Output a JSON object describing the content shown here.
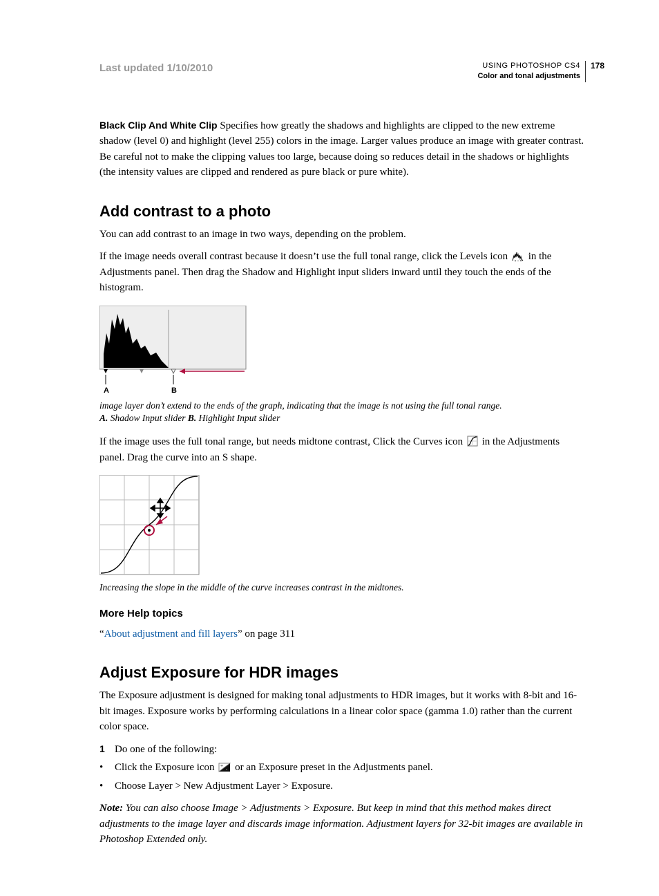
{
  "header": {
    "lastUpdated": "Last updated 1/10/2010",
    "product": "USING PHOTOSHOP CS4",
    "chapter": "Color and tonal adjustments",
    "pageNumber": "178"
  },
  "blackWhiteClip": {
    "runIn": "Black Clip And White Clip",
    "body": " Specifies how greatly the shadows and highlights are clipped to the new extreme shadow (level 0) and highlight (level 255) colors in the image. Larger values produce an image with greater contrast. Be careful not to make the clipping values too large, because doing so reduces detail in the shadows or highlights (the intensity values are clipped and rendered as pure black or pure white)."
  },
  "section1": {
    "heading": "Add contrast to a photo",
    "p1": "You can add contrast to an image in two ways, depending on the problem.",
    "p2a": "If the image needs overall contrast because it doesn’t use the full tonal range, click the Levels icon ",
    "p2b": " in the Adjustments panel. Then drag the Shadow and Highlight input sliders inward until they touch the ends of the histogram.",
    "caption1Line1": "image layer don’t extend to the ends of the graph, indicating that the image is not using the full tonal range.",
    "caption1ALabel": "A.",
    "caption1AText": " Shadow Input slider  ",
    "caption1BLabel": "B.",
    "caption1BText": " Highlight Input slider",
    "p3a": "If the image uses the full tonal range, but needs midtone contrast, Click the Curves icon ",
    "p3b": " in the Adjustments panel. Drag the curve into an S shape.",
    "caption2": "Increasing the slope in the middle of the curve increases contrast in the midtones."
  },
  "moreHelp": {
    "heading": "More Help topics",
    "linkText": "About adjustment and fill layers",
    "suffix": " on page 311"
  },
  "section2": {
    "heading": "Adjust Exposure for HDR images",
    "p1": "The Exposure adjustment is designed for making tonal adjustments to HDR images, but it works with 8-bit and 16-bit images. Exposure works by performing calculations in a linear color space (gamma 1.0) rather than the current color space.",
    "step1Marker": "1",
    "step1": "Do one of the following:",
    "bullet1a": "Click the Exposure icon ",
    "bullet1b": " or an Exposure preset in the Adjustments panel.",
    "bullet2": "Choose Layer > New Adjustment Layer > Exposure.",
    "noteLead": "Note:",
    "noteBody": " You can also choose Image > Adjustments > Exposure. But keep in mind that this method makes direct adjustments to the image layer and discards image information. Adjustment layers for 32-bit images are available in Photoshop Extended only."
  },
  "labels": {
    "A": "A",
    "B": "B"
  }
}
